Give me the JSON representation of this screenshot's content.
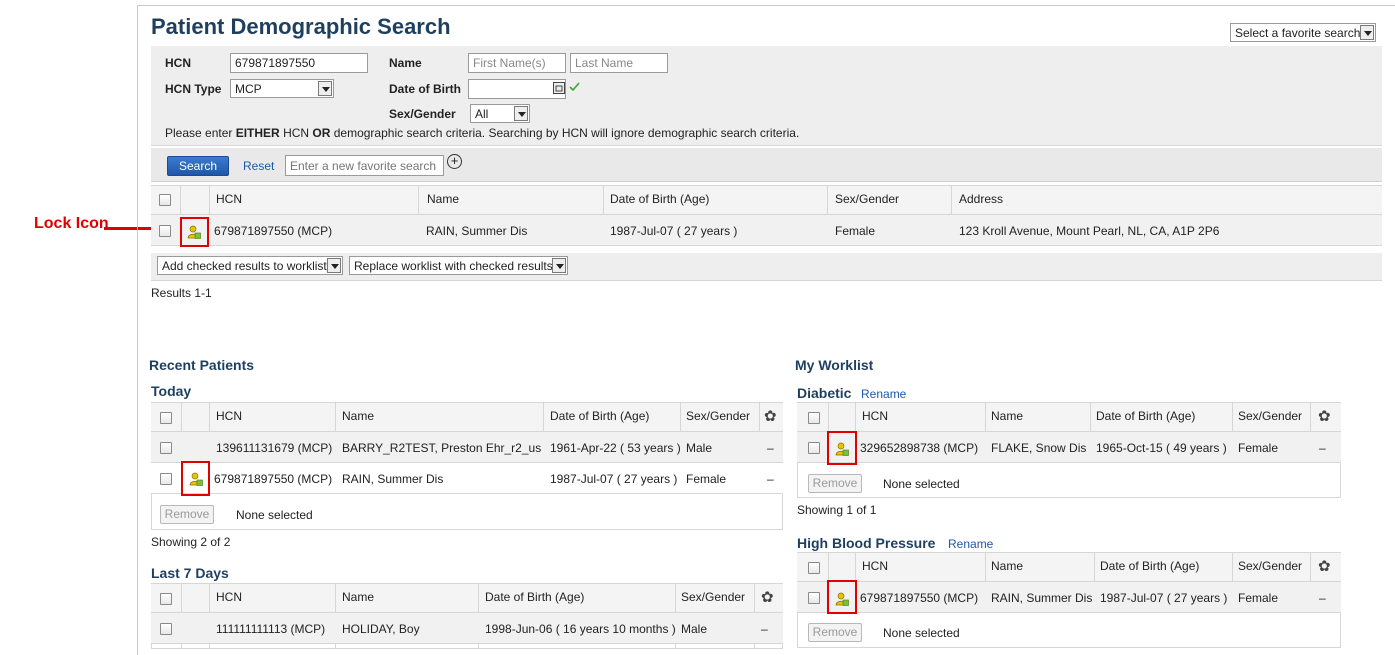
{
  "callout": {
    "label": "Lock Icon"
  },
  "page": {
    "title": "Patient Demographic Search"
  },
  "favorite": {
    "select_label": "Select a favorite search"
  },
  "search": {
    "hcn_label": "HCN",
    "hcn_value": "679871897550",
    "hcn_type_label": "HCN Type",
    "hcn_type_value": "MCP",
    "name_label": "Name",
    "first_name_placeholder": "First Name(s)",
    "last_name_placeholder": "Last Name",
    "dob_label": "Date of Birth",
    "sex_label": "Sex/Gender",
    "sex_value": "All",
    "note_prefix": "Please enter ",
    "note_either": "EITHER",
    "note_mid": " HCN ",
    "note_or": "OR",
    "note_suffix": " demographic search criteria. Searching by HCN will ignore demographic search criteria."
  },
  "buttons": {
    "search": "Search",
    "reset": "Reset",
    "new_favorite_placeholder": "Enter a new favorite search",
    "add_favorite": "+"
  },
  "results": {
    "headers": [
      "HCN",
      "Name",
      "Date of Birth (Age)",
      "Sex/Gender",
      "Address"
    ],
    "rows": [
      {
        "hcn": "679871897550 (MCP)",
        "name": "RAIN, Summer Dis",
        "dob": "1987-Jul-07 ( 27 years )",
        "sex": "Female",
        "address": "123 Kroll Avenue, Mount Pearl, NL, CA, A1P 2P6"
      }
    ],
    "add_checked": "Add checked results to worklist",
    "replace_worklist": "Replace worklist with checked results",
    "count_text": "Results 1-1"
  },
  "recent": {
    "title": "Recent Patients",
    "today": {
      "title": "Today",
      "headers": [
        "HCN",
        "Name",
        "Date of Birth (Age)",
        "Sex/Gender"
      ],
      "rows": [
        {
          "hcn": "139611131679 (MCP)",
          "name": "BARRY_R2TEST, Preston Ehr_r2_us",
          "dob": "1961-Apr-22 ( 53 years )",
          "sex": "Male",
          "action": "–"
        },
        {
          "hcn": "679871897550 (MCP)",
          "name": "RAIN, Summer Dis",
          "dob": "1987-Jul-07 ( 27 years )",
          "sex": "Female",
          "action": "–"
        }
      ],
      "remove": "Remove",
      "none_selected": "None selected",
      "showing": "Showing 2 of 2"
    },
    "last7": {
      "title": "Last 7 Days",
      "headers": [
        "HCN",
        "Name",
        "Date of Birth (Age)",
        "Sex/Gender"
      ],
      "rows": [
        {
          "hcn": "111111111113 (MCP)",
          "name": "HOLIDAY, Boy",
          "dob": "1998-Jun-06 ( 16 years 10 months )",
          "sex": "Male",
          "action": "–"
        }
      ]
    }
  },
  "worklist": {
    "title": "My Worklist",
    "diabetic": {
      "title": "Diabetic",
      "rename": "Rename",
      "headers": [
        "HCN",
        "Name",
        "Date of Birth (Age)",
        "Sex/Gender"
      ],
      "rows": [
        {
          "hcn": "329652898738 (MCP)",
          "name": "FLAKE, Snow Dis",
          "dob": "1965-Oct-15 ( 49 years )",
          "sex": "Female",
          "action": "–"
        }
      ],
      "remove": "Remove",
      "none_selected": "None selected",
      "showing": "Showing 1 of 1"
    },
    "hbp": {
      "title": "High Blood Pressure",
      "rename": "Rename",
      "headers": [
        "HCN",
        "Name",
        "Date of Birth (Age)",
        "Sex/Gender"
      ],
      "rows": [
        {
          "hcn": "679871897550 (MCP)",
          "name": "RAIN, Summer Dis",
          "dob": "1987-Jul-07 ( 27 years )",
          "sex": "Female",
          "action": "–"
        }
      ],
      "remove": "Remove",
      "none_selected": "None selected"
    }
  },
  "icons": {
    "lock": "lock-person-icon",
    "gear": "gear-icon",
    "calendar": "calendar-icon",
    "check": "checkmark-icon"
  },
  "colors": {
    "title": "#1f3f5f",
    "accent": "#1f57a8",
    "callout": "#e00000"
  }
}
